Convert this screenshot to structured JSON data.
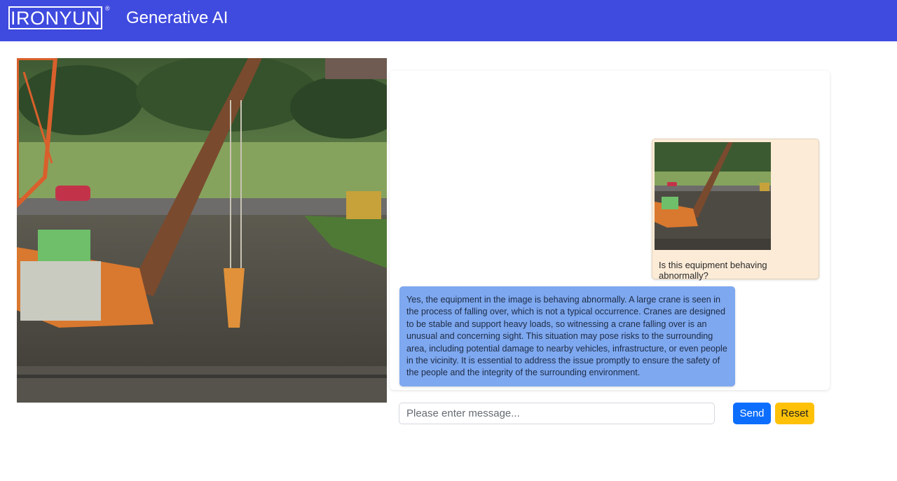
{
  "header": {
    "logo_text": "IRONYUN",
    "logo_mark": "®",
    "title": "Generative AI"
  },
  "main_image": {
    "alt": "Photo of a crawler crane tipping over on a muddy construction site"
  },
  "chat": {
    "messages": [
      {
        "role": "user",
        "image_alt": "Thumbnail of the crane photo",
        "text": "Is this equipment behaving abnormally?"
      },
      {
        "role": "assistant",
        "text": "Yes, the equipment in the image is behaving abnormally. A large crane is seen in the process of falling over, which is not a typical occurrence. Cranes are designed to be stable and support heavy loads, so witnessing a crane falling over is an unusual and concerning sight. This situation may pose risks to the surrounding area, including potential damage to nearby vehicles, infrastructure, or even people in the vicinity. It is essential to address the issue promptly to ensure the safety of the people and the integrity of the surrounding environment."
      }
    ]
  },
  "composer": {
    "placeholder": "Please enter message...",
    "value": "",
    "send_label": "Send",
    "reset_label": "Reset"
  },
  "colors": {
    "header_bg": "#3f4adf",
    "user_bubble": "#fcebd7",
    "assistant_bubble": "#7ea8ef",
    "send_button": "#0d6efd",
    "reset_button": "#ffc107"
  }
}
